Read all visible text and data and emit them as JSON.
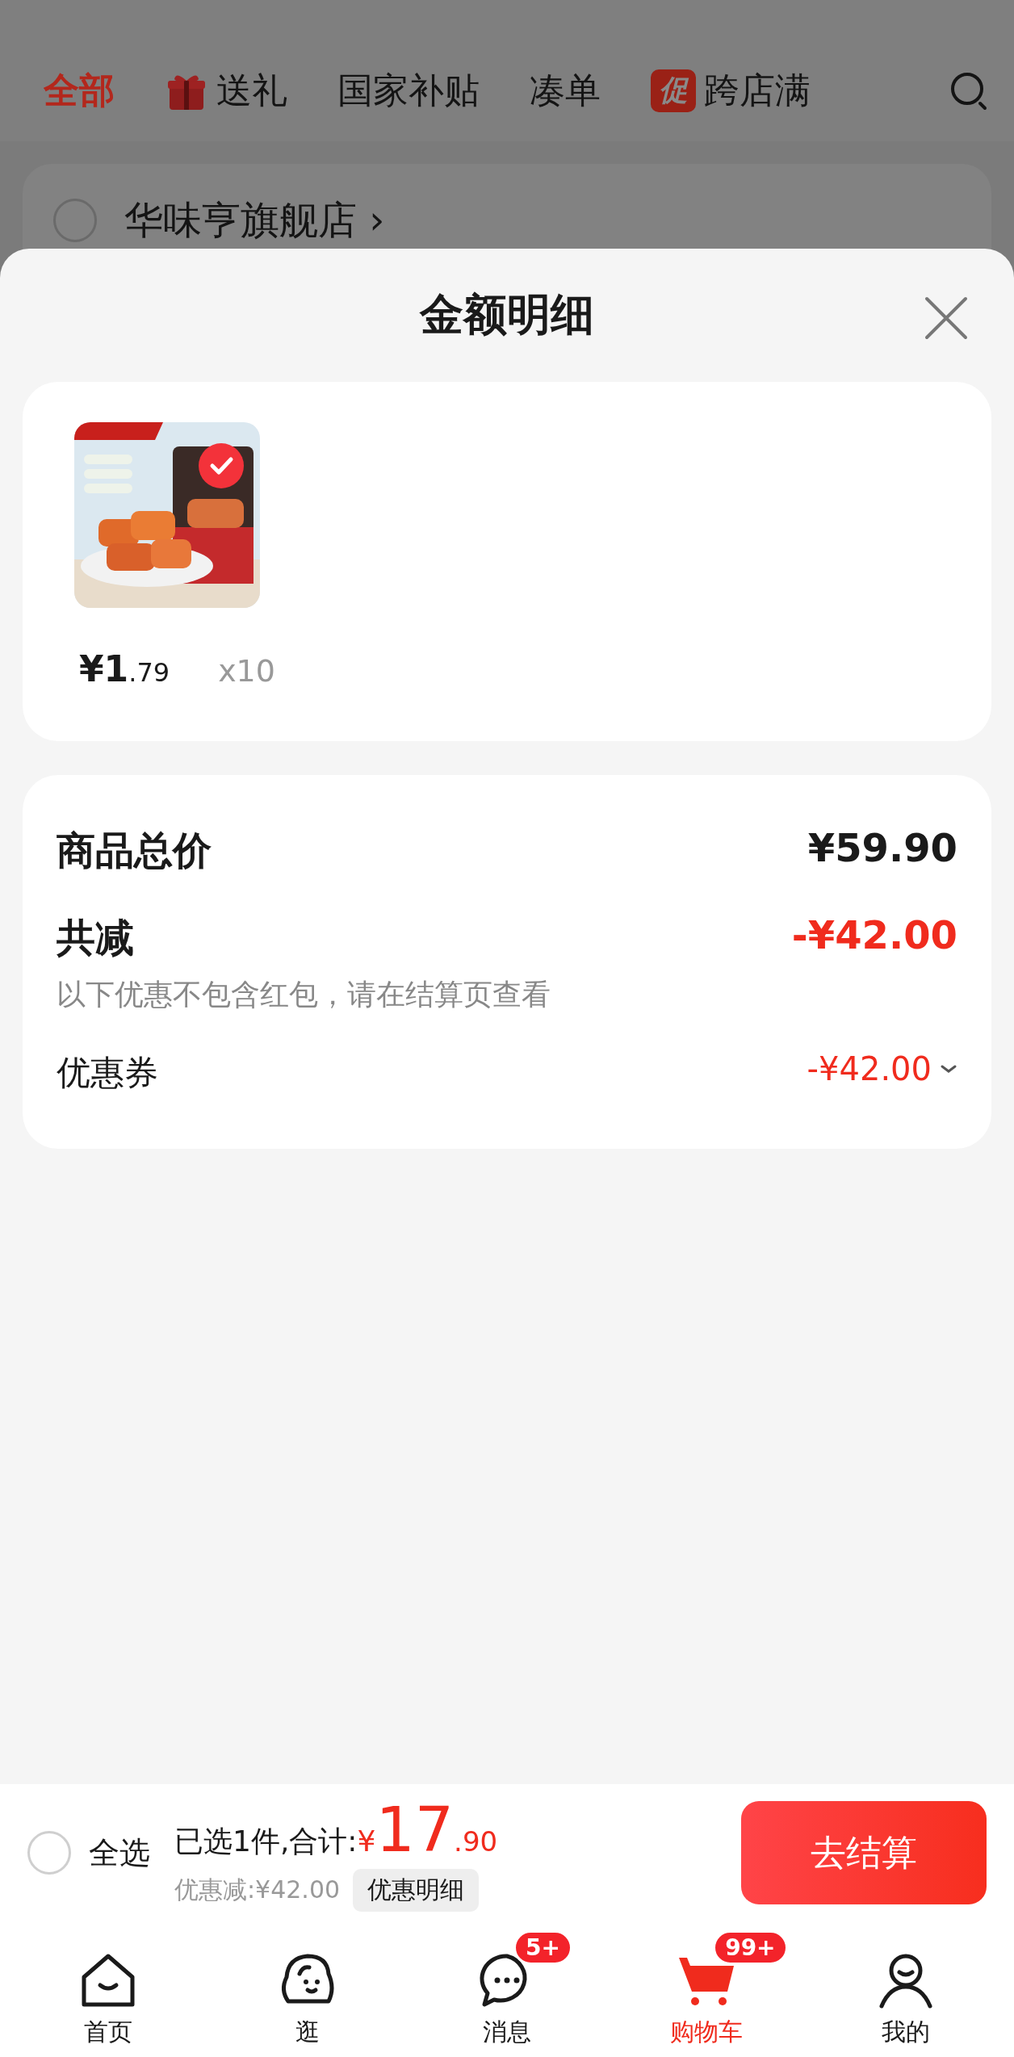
{
  "top_tabs": [
    {
      "label": "全部",
      "selected": true,
      "kind": "text"
    },
    {
      "label": "送礼",
      "selected": false,
      "kind": "gift"
    },
    {
      "label": "国家补贴",
      "selected": false,
      "kind": "text"
    },
    {
      "label": "凑单",
      "selected": false,
      "kind": "text"
    },
    {
      "label": "跨店满",
      "selected": false,
      "kind": "promo",
      "badge": "促"
    }
  ],
  "store": {
    "name": "华味亨旗舰店",
    "chevron": "›",
    "checked": false
  },
  "sheet": {
    "title": "金额明细"
  },
  "product": {
    "checked": true,
    "price_main": "¥1",
    "price_decimal": ".79",
    "quantity": "x10"
  },
  "summary": [
    {
      "kind": "total",
      "label": "商品总价",
      "value": "¥59.90"
    },
    {
      "kind": "discount",
      "label": "共减",
      "value": "-¥42.00",
      "note": "以下优惠不包含红包，请在结算页查看"
    },
    {
      "kind": "coupon",
      "label": "优惠券",
      "value": "-¥42.00"
    }
  ],
  "bottom_bar": {
    "select_all": {
      "label": "全选",
      "checked": false
    },
    "selected_text": "已选1件,合计:",
    "currency": "¥",
    "total_int": "17",
    "total_decimal": ".90",
    "discount": "优惠减:¥42.00",
    "details_button": "优惠明细",
    "checkout": "去结算"
  },
  "nav": [
    {
      "label": "首页",
      "kind": "home",
      "selected": false
    },
    {
      "label": "逛",
      "kind": "explore",
      "selected": false
    },
    {
      "label": "消息",
      "kind": "message",
      "selected": false,
      "badge": "5+"
    },
    {
      "label": "购物车",
      "kind": "cart",
      "selected": true,
      "badge": "99+"
    },
    {
      "label": "我的",
      "kind": "user",
      "selected": false
    }
  ]
}
